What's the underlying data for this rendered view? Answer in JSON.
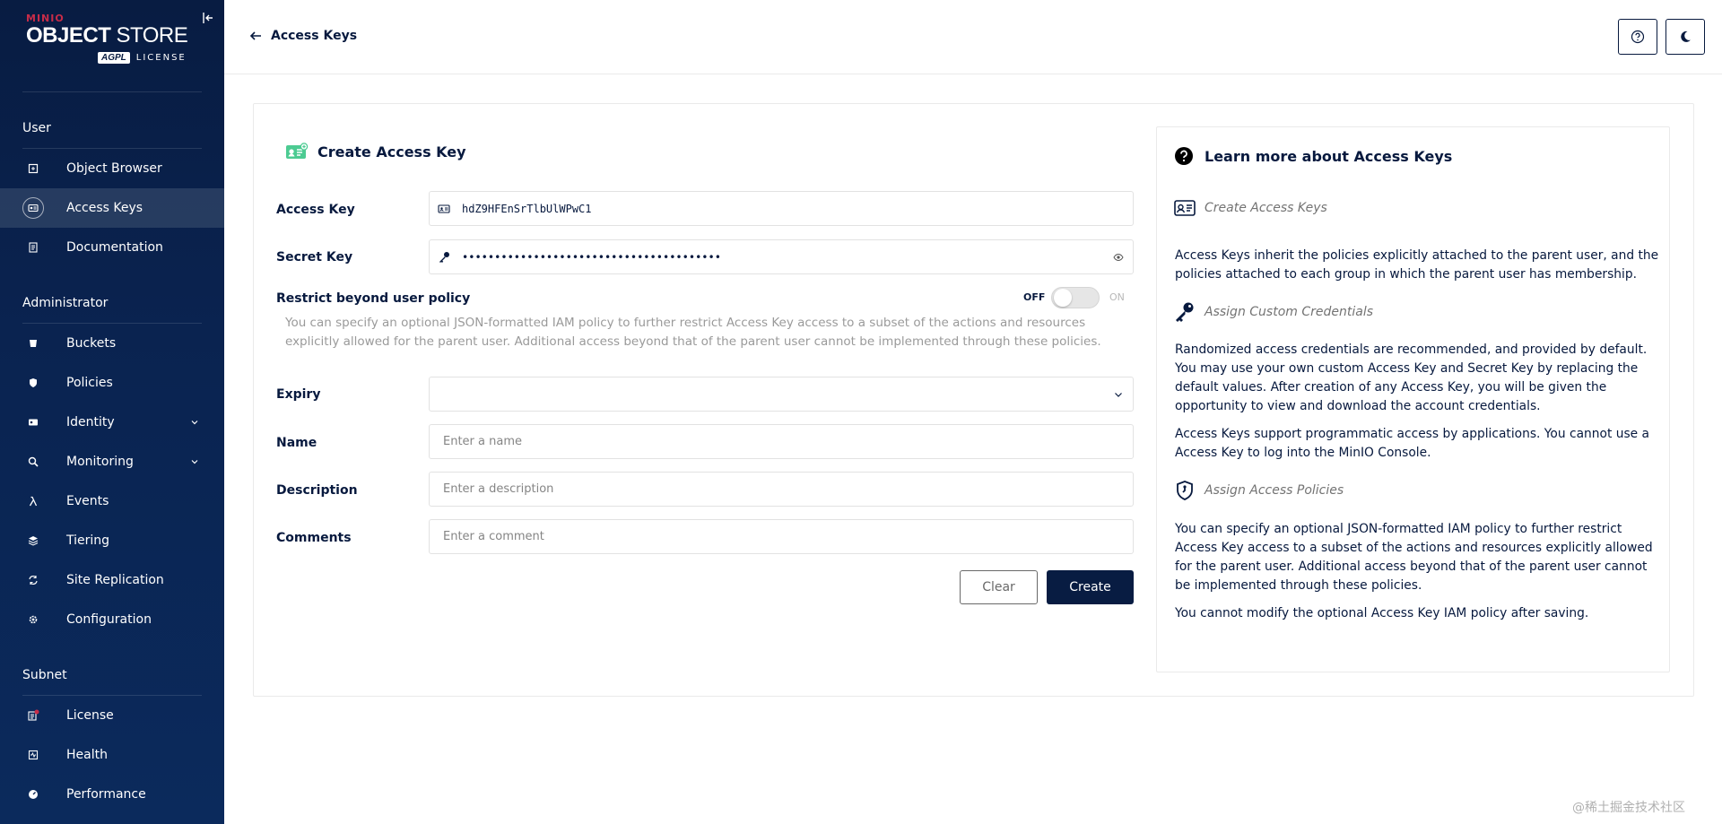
{
  "sidebar": {
    "logo": {
      "brand_a": "MIN",
      "brand_b": "IO",
      "title_a": "OBJECT",
      "title_b": "STORE",
      "badge": "AGPL",
      "license": "LICENSE"
    },
    "sections": [
      {
        "label": "User"
      },
      {
        "label": "Administrator"
      },
      {
        "label": "Subnet"
      }
    ],
    "items": [
      {
        "label": "Object Browser",
        "icon": "object-browser-icon",
        "active": false
      },
      {
        "label": "Access Keys",
        "icon": "access-keys-icon",
        "active": true
      },
      {
        "label": "Documentation",
        "icon": "documentation-icon",
        "active": false
      },
      {
        "label": "Buckets",
        "icon": "buckets-icon",
        "active": false
      },
      {
        "label": "Policies",
        "icon": "policies-icon",
        "active": false
      },
      {
        "label": "Identity",
        "icon": "identity-icon",
        "active": false,
        "expandable": true
      },
      {
        "label": "Monitoring",
        "icon": "monitoring-icon",
        "active": false,
        "expandable": true
      },
      {
        "label": "Events",
        "icon": "lambda-icon",
        "active": false
      },
      {
        "label": "Tiering",
        "icon": "tiering-icon",
        "active": false
      },
      {
        "label": "Site Replication",
        "icon": "site-replication-icon",
        "active": false
      },
      {
        "label": "Configuration",
        "icon": "gear-icon",
        "active": false
      },
      {
        "label": "License",
        "icon": "license-icon",
        "active": false
      },
      {
        "label": "Health",
        "icon": "health-icon",
        "active": false
      },
      {
        "label": "Performance",
        "icon": "performance-icon",
        "active": false
      }
    ]
  },
  "header": {
    "back_label": "Access Keys"
  },
  "form": {
    "title": "Create Access Key",
    "access_key": {
      "label": "Access Key",
      "value": "hdZ9HFEnSrTlbUlWPwC1"
    },
    "secret_key": {
      "label": "Secret Key",
      "value": "••••••••••••••••••••••••••••••••••••••••"
    },
    "restrict": {
      "label": "Restrict beyond user policy",
      "off": "OFF",
      "on": "ON",
      "help": "You can specify an optional JSON-formatted IAM policy to further restrict Access Key access to a subset of the actions and resources explicitly allowed for the parent user. Additional access beyond that of the parent user cannot be implemented through these policies."
    },
    "expiry": {
      "label": "Expiry"
    },
    "name": {
      "label": "Name",
      "placeholder": "Enter a name"
    },
    "description": {
      "label": "Description",
      "placeholder": "Enter a description"
    },
    "comments": {
      "label": "Comments",
      "placeholder": "Enter a comment"
    },
    "clear_label": "Clear",
    "create_label": "Create"
  },
  "help": {
    "title": "Learn more about Access Keys",
    "sub1": "Create Access Keys",
    "p1": "Access Keys inherit the policies explicitly attached to the parent user, and the policies attached to each group in which the parent user has membership.",
    "sub2": "Assign Custom Credentials",
    "p2": "Randomized access credentials are recommended, and provided by default. You may use your own custom Access Key and Secret Key by replacing the default values. After creation of any Access Key, you will be given the opportunity to view and download the account credentials.",
    "p3": "Access Keys support programmatic access by applications. You cannot use a Access Key to log into the MinIO Console.",
    "sub3": "Assign Access Policies",
    "p4": "You can specify an optional JSON-formatted IAM policy to further restrict Access Key access to a subset of the actions and resources explicitly allowed for the parent user. Additional access beyond that of the parent user cannot be implemented through these policies.",
    "p5": "You cannot modify the optional Access Key IAM policy after saving."
  },
  "watermark": "@稀土掘金技术社区",
  "colors": {
    "sidebar_bg": "#081c42",
    "brand_red": "#c72c48",
    "primary": "#081c42",
    "border": "#e2e2e2"
  }
}
